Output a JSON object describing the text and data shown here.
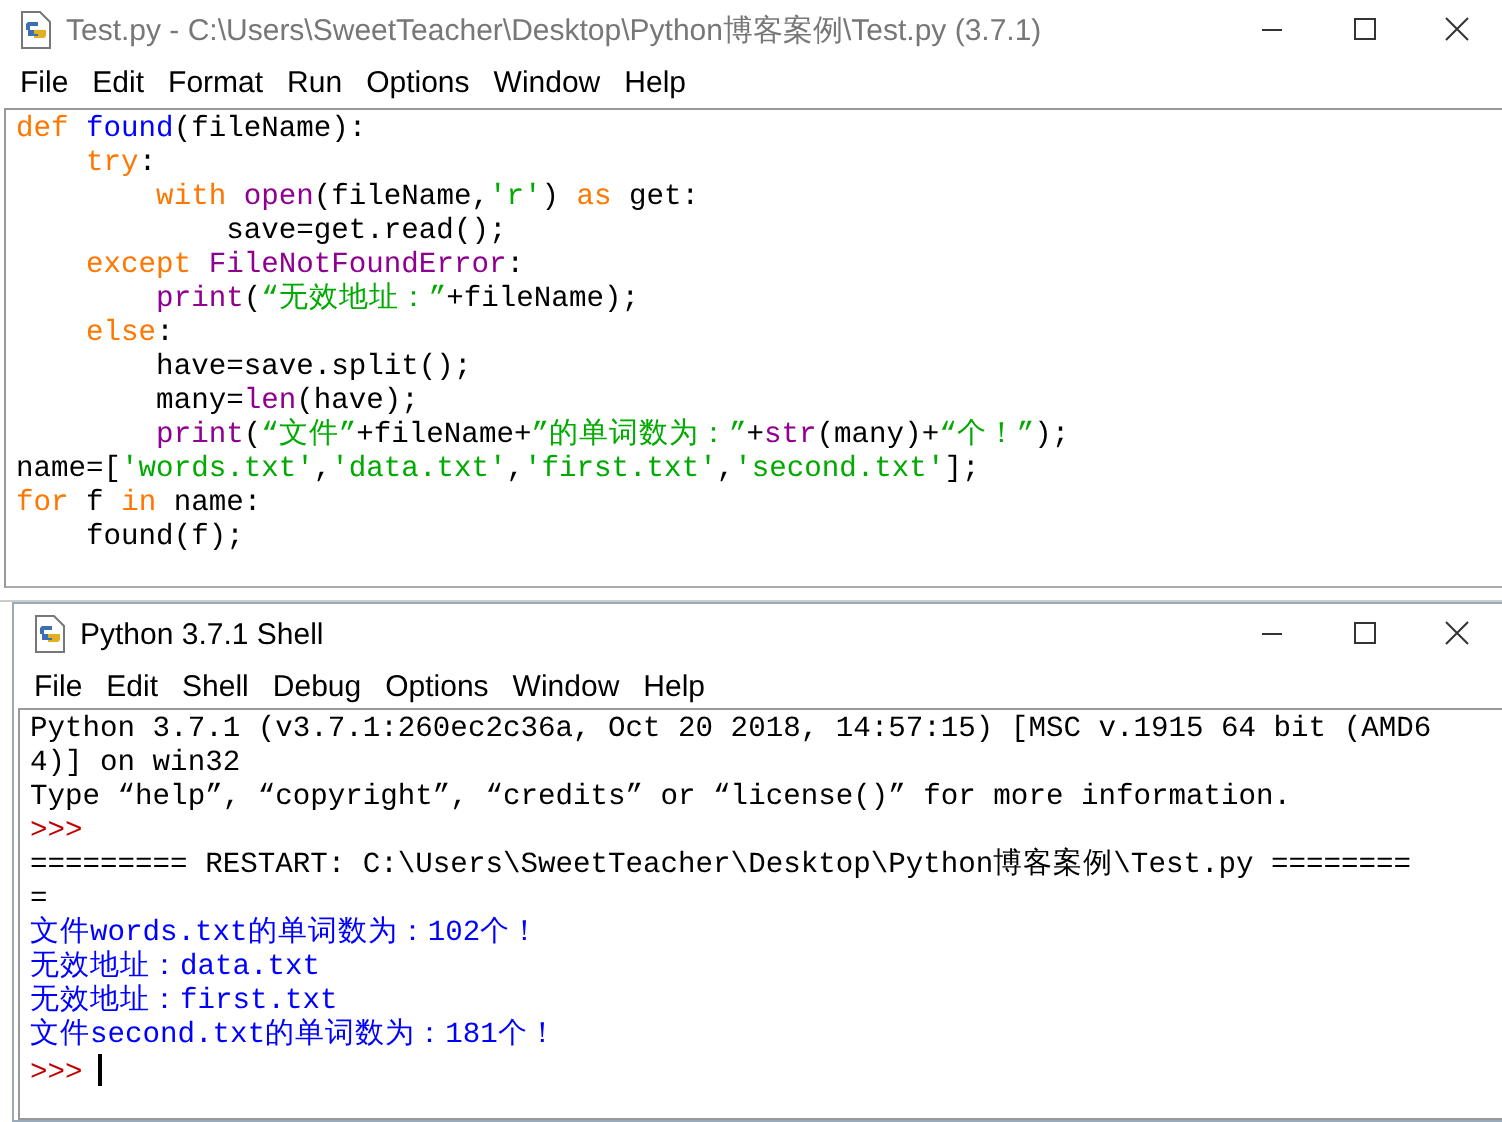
{
  "editor": {
    "title": "Test.py - C:\\Users\\SweetTeacher\\Desktop\\Python博客案例\\Test.py (3.7.1)",
    "menu": [
      "File",
      "Edit",
      "Format",
      "Run",
      "Options",
      "Window",
      "Help"
    ],
    "code_lines": [
      [
        {
          "kind": "keyword",
          "text": "def "
        },
        {
          "kind": "definition",
          "text": "found"
        },
        {
          "kind": "plain",
          "text": "(fileName):"
        }
      ],
      [
        {
          "kind": "keyword",
          "text": "    try"
        },
        {
          "kind": "plain",
          "text": ":"
        }
      ],
      [
        {
          "kind": "keyword",
          "text": "        with "
        },
        {
          "kind": "builtin",
          "text": "open"
        },
        {
          "kind": "plain",
          "text": "(fileName,"
        },
        {
          "kind": "string",
          "text": "'r'"
        },
        {
          "kind": "plain",
          "text": ") "
        },
        {
          "kind": "keyword",
          "text": "as"
        },
        {
          "kind": "plain",
          "text": " get:"
        }
      ],
      [
        {
          "kind": "plain",
          "text": "            save=get.read();"
        }
      ],
      [
        {
          "kind": "keyword",
          "text": "    except "
        },
        {
          "kind": "builtin",
          "text": "FileNotFoundError"
        },
        {
          "kind": "plain",
          "text": ":"
        }
      ],
      [
        {
          "kind": "builtin",
          "text": "        print"
        },
        {
          "kind": "plain",
          "text": "("
        },
        {
          "kind": "string",
          "text": "“无效地址：”"
        },
        {
          "kind": "plain",
          "text": "+fileName);"
        }
      ],
      [
        {
          "kind": "keyword",
          "text": "    else"
        },
        {
          "kind": "plain",
          "text": ":"
        }
      ],
      [
        {
          "kind": "plain",
          "text": "        have=save.split();"
        }
      ],
      [
        {
          "kind": "plain",
          "text": "        many="
        },
        {
          "kind": "builtin",
          "text": "len"
        },
        {
          "kind": "plain",
          "text": "(have);"
        }
      ],
      [
        {
          "kind": "builtin",
          "text": "        print"
        },
        {
          "kind": "plain",
          "text": "("
        },
        {
          "kind": "string",
          "text": "“文件”"
        },
        {
          "kind": "plain",
          "text": "+fileName+"
        },
        {
          "kind": "string",
          "text": "”的单词数为：”"
        },
        {
          "kind": "plain",
          "text": "+"
        },
        {
          "kind": "builtin",
          "text": "str"
        },
        {
          "kind": "plain",
          "text": "(many)+"
        },
        {
          "kind": "string",
          "text": "“个！”"
        },
        {
          "kind": "plain",
          "text": ");"
        }
      ],
      [
        {
          "kind": "plain",
          "text": "name=["
        },
        {
          "kind": "string",
          "text": "'words.txt'"
        },
        {
          "kind": "plain",
          "text": ","
        },
        {
          "kind": "string",
          "text": "'data.txt'"
        },
        {
          "kind": "plain",
          "text": ","
        },
        {
          "kind": "string",
          "text": "'first.txt'"
        },
        {
          "kind": "plain",
          "text": ","
        },
        {
          "kind": "string",
          "text": "'second.txt'"
        },
        {
          "kind": "plain",
          "text": "];"
        }
      ],
      [
        {
          "kind": "keyword",
          "text": "for"
        },
        {
          "kind": "plain",
          "text": " f "
        },
        {
          "kind": "keyword",
          "text": "in"
        },
        {
          "kind": "plain",
          "text": " name:"
        }
      ],
      [
        {
          "kind": "plain",
          "text": "    found(f);"
        }
      ]
    ]
  },
  "shell": {
    "title": "Python 3.7.1 Shell",
    "menu": [
      "File",
      "Edit",
      "Shell",
      "Debug",
      "Options",
      "Window",
      "Help"
    ],
    "lines": [
      {
        "kind": "banner",
        "text": "Python 3.7.1 (v3.7.1:260ec2c36a, Oct 20 2018, 14:57:15) [MSC v.1915 64 bit (AMD6"
      },
      {
        "kind": "banner",
        "text": "4)] on win32"
      },
      {
        "kind": "banner",
        "text": "Type “help”, “copyright”, “credits” or “license()” for more information."
      },
      {
        "kind": "prompt",
        "text": ">>>"
      },
      {
        "kind": "banner",
        "text": "========= RESTART: C:\\Users\\SweetTeacher\\Desktop\\Python博客案例\\Test.py ========"
      },
      {
        "kind": "banner",
        "text": "="
      },
      {
        "kind": "output",
        "text": "文件words.txt的单词数为：102个！"
      },
      {
        "kind": "output",
        "text": "无效地址：data.txt"
      },
      {
        "kind": "output",
        "text": "无效地址：first.txt"
      },
      {
        "kind": "output",
        "text": "文件second.txt的单词数为：181个！"
      },
      {
        "kind": "prompt",
        "text": ">>>",
        "cursor": true
      }
    ]
  }
}
